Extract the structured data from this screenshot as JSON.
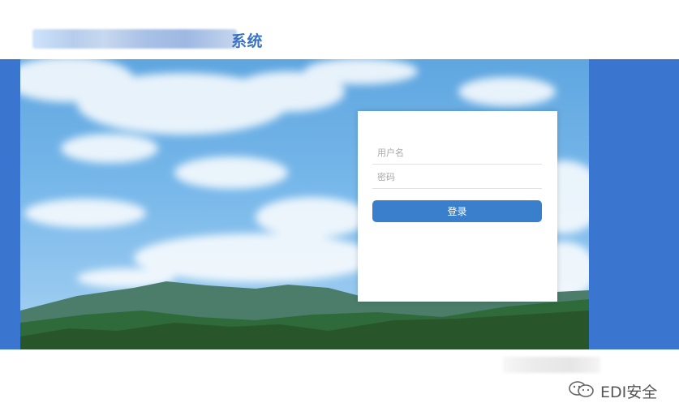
{
  "header": {
    "title_visible_suffix": "系统"
  },
  "login": {
    "username_placeholder": "用户名",
    "password_placeholder": "密码",
    "submit_label": "登录"
  },
  "watermark": {
    "text": "EDI安全",
    "icon": "wechat-icon"
  },
  "colors": {
    "band": "#3a75cf",
    "button": "#3a7fcb",
    "title": "#3a73c6"
  }
}
